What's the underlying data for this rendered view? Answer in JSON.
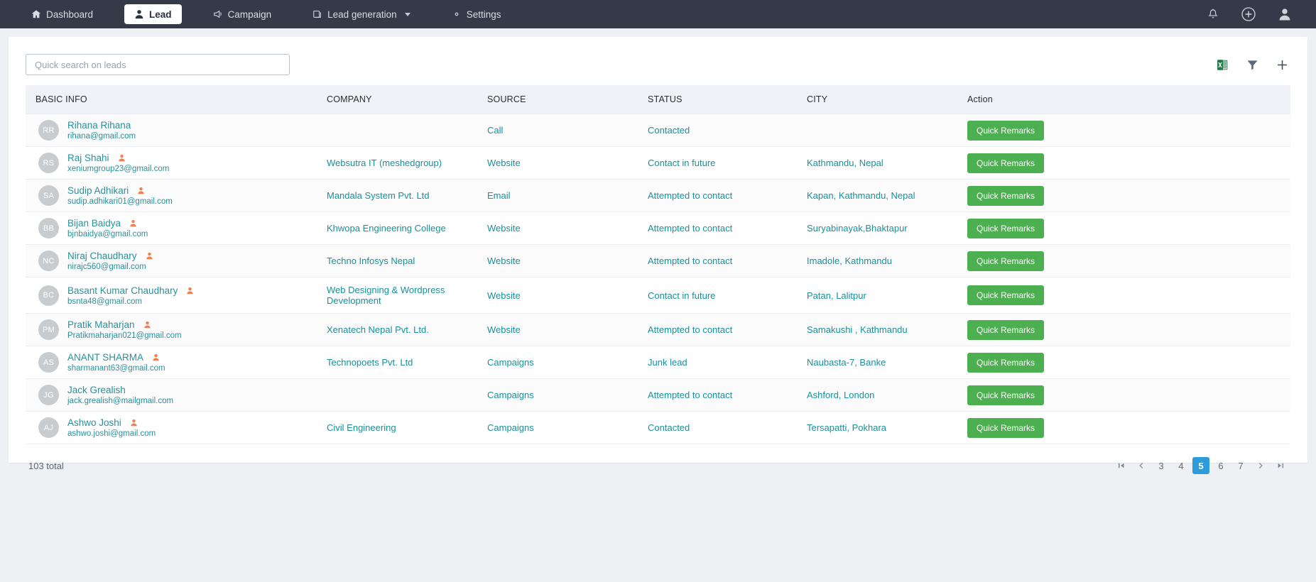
{
  "navbar": {
    "items": [
      {
        "label": "Dashboard",
        "icon": "home-icon",
        "active": false,
        "caret": false
      },
      {
        "label": "Lead",
        "icon": "person-icon",
        "active": true,
        "caret": false
      },
      {
        "label": "Campaign",
        "icon": "megaphone-icon",
        "active": false,
        "caret": false
      },
      {
        "label": "Lead generation",
        "icon": "window-icon",
        "active": false,
        "caret": true
      },
      {
        "label": "Settings",
        "icon": "gear-icon",
        "active": false,
        "caret": false
      }
    ],
    "right_icons": [
      "bell-icon",
      "plus-circle-icon",
      "user-avatar-icon"
    ]
  },
  "toolbar": {
    "search_placeholder": "Quick search on leads",
    "search_value": "",
    "actions": [
      "excel-export-icon",
      "filter-icon",
      "add-icon"
    ]
  },
  "table": {
    "columns": [
      "BASIC INFO",
      "COMPANY",
      "SOURCE",
      "STATUS",
      "CITY",
      "Action"
    ],
    "action_label": "Quick Remarks",
    "rows": [
      {
        "initials": "RR",
        "name": "Rihana Rihana",
        "email": "rihana@gmail.com",
        "flag": false,
        "company": "",
        "source": "Call",
        "status": "Contacted",
        "city": ""
      },
      {
        "initials": "RS",
        "name": "Raj Shahi",
        "email": "xeniumgroup23@gmail.com",
        "flag": true,
        "company": "Websutra IT (meshedgroup)",
        "source": "Website",
        "status": "Contact in future",
        "city": "Kathmandu, Nepal"
      },
      {
        "initials": "SA",
        "name": "Sudip Adhikari",
        "email": "sudip.adhikari01@gmail.com",
        "flag": true,
        "company": "Mandala System Pvt. Ltd",
        "source": "Email",
        "status": "Attempted to contact",
        "city": "Kapan, Kathmandu, Nepal"
      },
      {
        "initials": "BB",
        "name": "Bijan Baidya",
        "email": "bjnbaidya@gmail.com",
        "flag": true,
        "company": "Khwopa Engineering College",
        "source": "Website",
        "status": "Attempted to contact",
        "city": "Suryabinayak,Bhaktapur"
      },
      {
        "initials": "NC",
        "name": "Niraj Chaudhary",
        "email": "nirajc560@gmail.com",
        "flag": true,
        "company": "Techno Infosys Nepal",
        "source": "Website",
        "status": "Attempted to contact",
        "city": "Imadole, Kathmandu"
      },
      {
        "initials": "BC",
        "name": "Basant Kumar Chaudhary",
        "email": "bsnta48@gmail.com",
        "flag": true,
        "company": "Web Designing & Wordpress Development",
        "source": "Website",
        "status": "Contact in future",
        "city": "Patan, Lalitpur"
      },
      {
        "initials": "PM",
        "name": "Pratik Maharjan",
        "email": "Pratikmaharjan021@gmail.com",
        "flag": true,
        "company": "Xenatech Nepal Pvt. Ltd.",
        "source": "Website",
        "status": "Attempted to contact",
        "city": "Samakushi , Kathmandu"
      },
      {
        "initials": "AS",
        "name": "ANANT SHARMA",
        "email": "sharmanant63@gmail.com",
        "flag": true,
        "company": "Technopoets Pvt. Ltd",
        "source": "Campaigns",
        "status": "Junk lead",
        "city": "Naubasta-7, Banke"
      },
      {
        "initials": "JG",
        "name": "Jack Grealish",
        "email": "jack.grealish@mailgmail.com",
        "flag": false,
        "company": "",
        "source": "Campaigns",
        "status": "Attempted to contact",
        "city": "Ashford, London"
      },
      {
        "initials": "AJ",
        "name": "Ashwo Joshi",
        "email": "ashwo.joshi@gmail.com",
        "flag": true,
        "company": "Civil Engineering",
        "source": "Campaigns",
        "status": "Contacted",
        "city": "Tersapatti, Pokhara"
      }
    ]
  },
  "footer": {
    "total_label": "103 total",
    "pages": [
      "3",
      "4",
      "5",
      "6",
      "7"
    ],
    "active_page": "5"
  },
  "colors": {
    "navbar_bg": "#343a47",
    "link_teal": "#17919b",
    "button_green": "#4caf50",
    "active_page_blue": "#2d9cdb",
    "flag_orange": "#f08050",
    "avatar_grey": "#c8ccce"
  }
}
